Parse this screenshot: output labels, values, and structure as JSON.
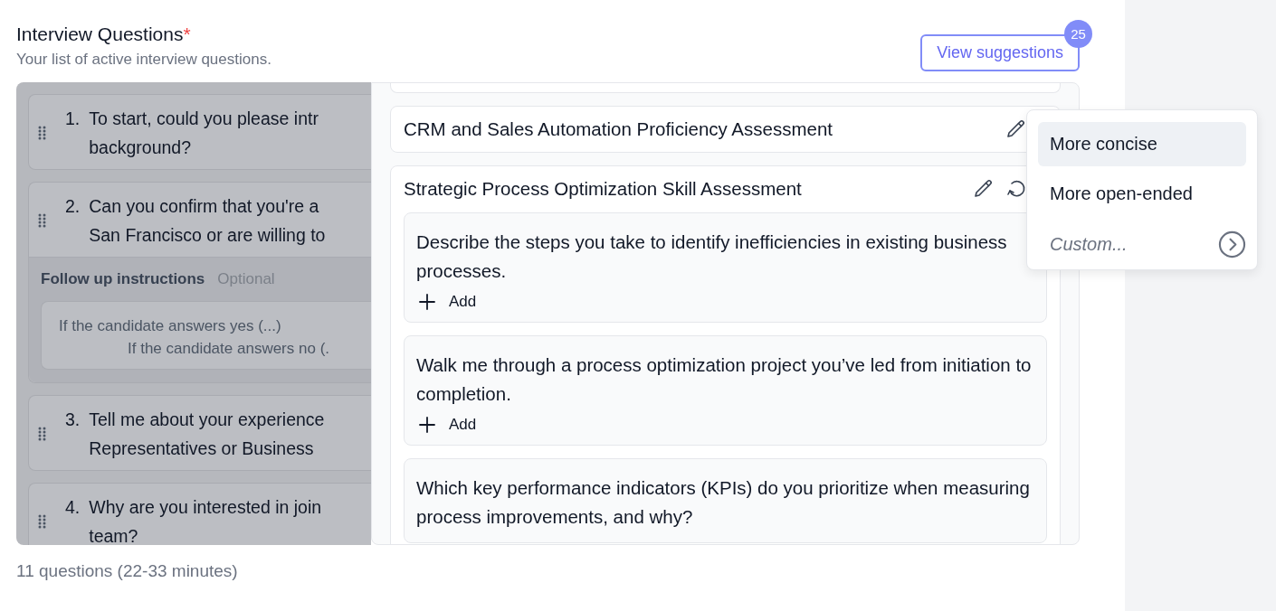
{
  "header": {
    "title": "Interview Questions",
    "required_mark": "*",
    "subtitle": "Your list of active interview questions.",
    "suggestions_button": {
      "label": "View suggestions",
      "badge": "25"
    }
  },
  "questions": [
    {
      "number": "1.",
      "lines": [
        "To start, could you please intr",
        "background?"
      ]
    },
    {
      "number": "2.",
      "lines": [
        "Can you confirm that you're a",
        "San Francisco or are willing to"
      ],
      "follow_up": {
        "label": "Follow up instructions",
        "hint": "Optional",
        "lines": [
          "If the candidate answers yes (...)",
          "If the candidate answers no (."
        ]
      }
    },
    {
      "number": "3.",
      "lines": [
        "Tell me about your experience",
        "Representatives or Business"
      ]
    },
    {
      "number": "4.",
      "lines": [
        "Why are you interested in join",
        "team?"
      ]
    }
  ],
  "suggestions": [
    {
      "title": "CRM and Sales Automation Proficiency Assessment",
      "expanded": false
    },
    {
      "title": "Strategic Process Optimization Skill Assessment",
      "expanded": true,
      "questions": [
        {
          "text": "Describe the steps you take to identify inefficiencies in existing business processes.",
          "add_label": "Add"
        },
        {
          "text": "Walk me through a process optimization project you’ve led from initiation to completion.",
          "add_label": "Add"
        },
        {
          "text": "Which key performance indicators (KPIs) do you prioritize when measuring process improvements, and why?"
        }
      ]
    }
  ],
  "rewrite_menu": {
    "options": [
      {
        "label": "More concise",
        "selected": true
      },
      {
        "label": "More open-ended",
        "selected": false
      }
    ],
    "custom_placeholder": "Custom..."
  },
  "footer": "11 questions (22-33 minutes)"
}
